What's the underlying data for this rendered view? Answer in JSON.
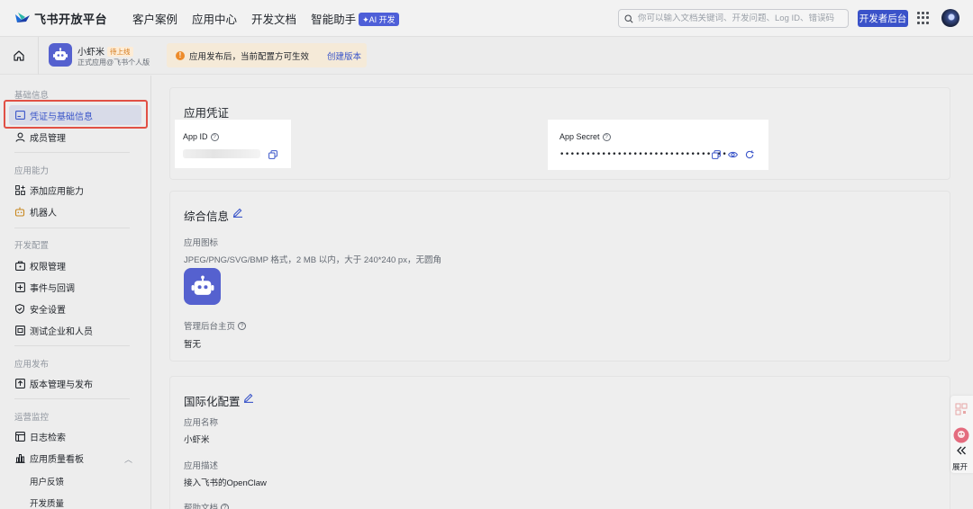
{
  "header": {
    "brand": "飞书开放平台",
    "nav": [
      "客户案例",
      "应用中心",
      "开发文档",
      "智能助手"
    ],
    "ai_badge": "✦AI 开发",
    "search_placeholder": "你可以输入文档关键词、开发问题、Log ID、错误码",
    "dev_console_label": "开发者后台"
  },
  "subbar": {
    "app_name": "小虾米",
    "app_status": "待上线",
    "app_subtitle": "正式应用@飞书个人版",
    "notice_icon": "!",
    "notice_text": "应用发布后，当前配置方可生效",
    "notice_link": "创建版本"
  },
  "sidebar": {
    "sections": [
      {
        "title": "基础信息",
        "items": [
          "凭证与基础信息",
          "成员管理"
        ]
      },
      {
        "title": "应用能力",
        "items": [
          "添加应用能力",
          "机器人"
        ]
      },
      {
        "title": "开发配置",
        "items": [
          "权限管理",
          "事件与回调",
          "安全设置",
          "测试企业和人员"
        ]
      },
      {
        "title": "应用发布",
        "items": [
          "版本管理与发布"
        ]
      },
      {
        "title": "运营监控",
        "items": [
          "日志检索",
          "应用质量看板"
        ],
        "sub_items": [
          "用户反馈",
          "开发质量"
        ]
      }
    ]
  },
  "credentials": {
    "title": "应用凭证",
    "app_id_label": "App ID",
    "app_secret_label": "App Secret",
    "app_secret_masked": "••••••••••••••••••••••••••••••••"
  },
  "general": {
    "title": "综合信息",
    "icon_label": "应用图标",
    "icon_hint": "JPEG/PNG/SVG/BMP 格式，2 MB 以内，大于 240*240 px，无圆角",
    "homepage_label": "管理后台主页",
    "homepage_value": "暂无"
  },
  "i18n": {
    "title": "国际化配置",
    "name_label": "应用名称",
    "name_value": "小虾米",
    "desc_label": "应用描述",
    "desc_value": "接入飞书的OpenClaw",
    "help_label": "帮助文档"
  },
  "float_panel": {
    "expand_label": "展开"
  },
  "colors": {
    "accent": "#3a52c9",
    "app_icon": "#5561cf",
    "highlight_border": "#e15045",
    "warning": "#ed8b2a"
  }
}
